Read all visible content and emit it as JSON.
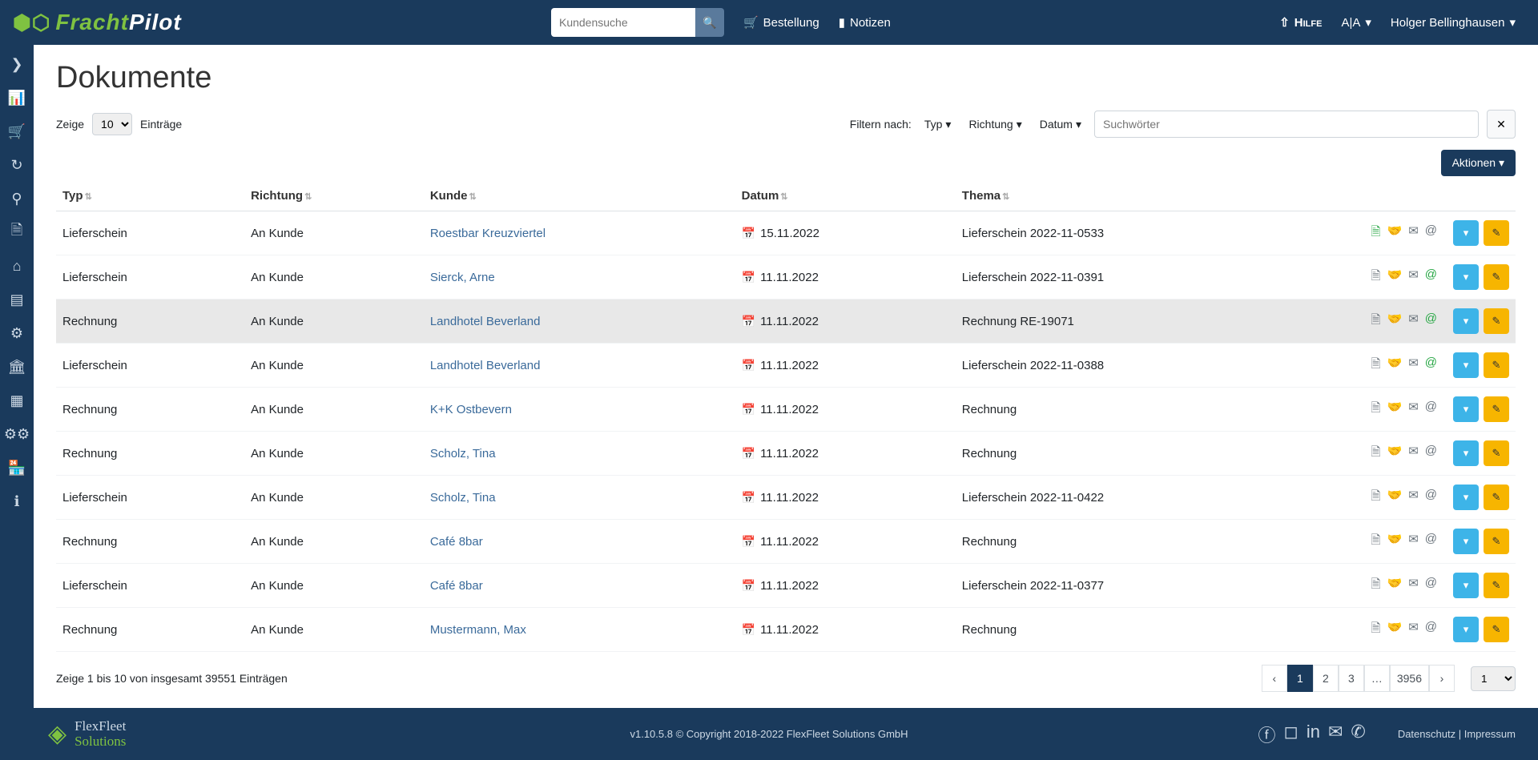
{
  "header": {
    "logo_first": "Fracht",
    "logo_second": "Pilot",
    "search_placeholder": "Kundensuche",
    "order_label": "Bestellung",
    "notes_label": "Notizen",
    "help_label": "Hilfe",
    "lang_label": "A|A",
    "user_name": "Holger Bellinghausen"
  },
  "page": {
    "title": "Dokumente",
    "show_label": "Zeige",
    "entries_label": "Einträge",
    "filter_label": "Filtern nach:",
    "filter_type": "Typ",
    "filter_direction": "Richtung",
    "filter_date": "Datum",
    "search_kw_placeholder": "Suchwörter",
    "actions_label": "Aktionen",
    "page_size": "10"
  },
  "columns": {
    "type": "Typ",
    "direction": "Richtung",
    "customer": "Kunde",
    "date": "Datum",
    "subject": "Thema"
  },
  "rows": [
    {
      "type": "Lieferschein",
      "direction": "An Kunde",
      "customer": "Roestbar Kreuzviertel",
      "date": "15.11.2022",
      "subject": "Lieferschein 2022-11-0533",
      "download_green": true,
      "at_green": false
    },
    {
      "type": "Lieferschein",
      "direction": "An Kunde",
      "customer": "Sierck, Arne",
      "date": "11.11.2022",
      "subject": "Lieferschein 2022-11-0391",
      "download_green": false,
      "at_green": true
    },
    {
      "type": "Rechnung",
      "direction": "An Kunde",
      "customer": "Landhotel Beverland",
      "date": "11.11.2022",
      "subject": "Rechnung RE-19071",
      "download_green": false,
      "at_green": true,
      "hovered": true
    },
    {
      "type": "Lieferschein",
      "direction": "An Kunde",
      "customer": "Landhotel Beverland",
      "date": "11.11.2022",
      "subject": "Lieferschein 2022-11-0388",
      "download_green": false,
      "at_green": true
    },
    {
      "type": "Rechnung",
      "direction": "An Kunde",
      "customer": "K+K Ostbevern",
      "date": "11.11.2022",
      "subject": "Rechnung",
      "download_green": false,
      "at_green": false
    },
    {
      "type": "Rechnung",
      "direction": "An Kunde",
      "customer": "Scholz, Tina",
      "date": "11.11.2022",
      "subject": "Rechnung",
      "download_green": false,
      "at_green": false
    },
    {
      "type": "Lieferschein",
      "direction": "An Kunde",
      "customer": "Scholz, Tina",
      "date": "11.11.2022",
      "subject": "Lieferschein 2022-11-0422",
      "download_green": false,
      "at_green": false
    },
    {
      "type": "Rechnung",
      "direction": "An Kunde",
      "customer": "Café 8bar",
      "date": "11.11.2022",
      "subject": "Rechnung",
      "download_green": false,
      "at_green": false
    },
    {
      "type": "Lieferschein",
      "direction": "An Kunde",
      "customer": "Café 8bar",
      "date": "11.11.2022",
      "subject": "Lieferschein 2022-11-0377",
      "download_green": false,
      "at_green": false
    },
    {
      "type": "Rechnung",
      "direction": "An Kunde",
      "customer": "Mustermann, Max",
      "date": "11.11.2022",
      "subject": "Rechnung",
      "download_green": false,
      "at_green": false
    }
  ],
  "footer_info": "Zeige 1 bis 10 von insgesamt 39551 Einträgen",
  "pagination": {
    "pages": [
      "1",
      "2",
      "3",
      "…",
      "3956"
    ],
    "active": "1",
    "jump": "1"
  },
  "footer": {
    "company_line1": "FlexFleet",
    "company_line2": "Solutions",
    "copyright": "v1.10.5.8 © Copyright 2018-2022 FlexFleet Solutions GmbH",
    "privacy": "Datenschutz",
    "imprint": "Impressum"
  }
}
